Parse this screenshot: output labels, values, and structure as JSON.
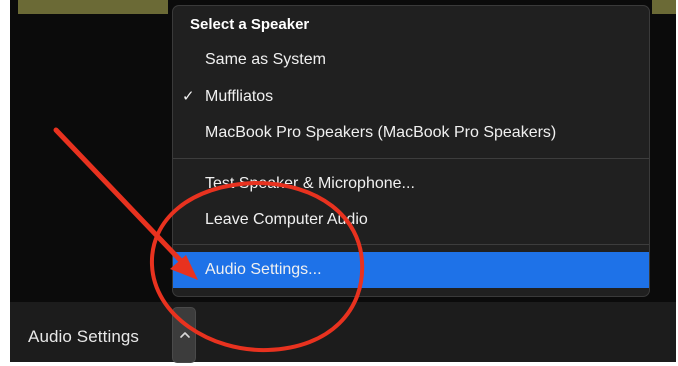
{
  "toolbar": {
    "audio_settings_label": "Audio Settings"
  },
  "menu": {
    "header": "Select a Speaker",
    "speakers": [
      {
        "label": "Same as System",
        "checked": false
      },
      {
        "label": "Muffliatos",
        "checked": true
      },
      {
        "label": "MacBook Pro Speakers (MacBook Pro Speakers)",
        "checked": false
      }
    ],
    "actions": [
      {
        "label": "Test Speaker & Microphone..."
      },
      {
        "label": "Leave Computer Audio"
      }
    ],
    "settings": {
      "label": "Audio Settings...",
      "highlighted": true
    },
    "check_glyph": "✓"
  },
  "icons": {
    "check": "checkmark-icon",
    "caret": "chevron-up-icon"
  },
  "colors": {
    "menu_bg": "#202020",
    "highlight": "#1e72e8",
    "annotation": "#e8321f",
    "toolbar_bg": "#1c1c1c"
  }
}
